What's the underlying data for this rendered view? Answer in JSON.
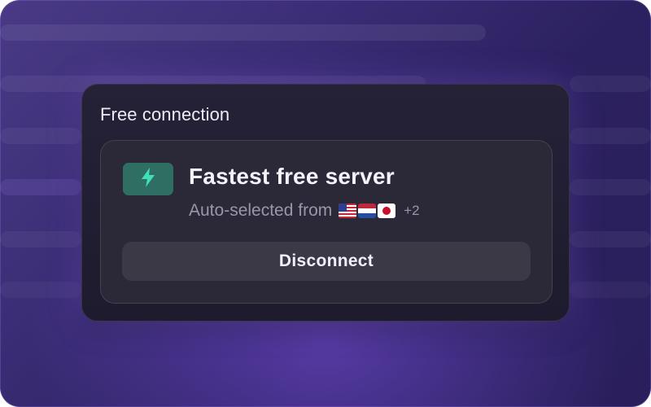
{
  "panel": {
    "title": "Free connection"
  },
  "server_card": {
    "title": "Fastest free server",
    "subtitle": "Auto-selected from",
    "flags": [
      "us-flag-icon",
      "nl-flag-icon",
      "jp-flag-icon"
    ],
    "more_count": "+2",
    "accent_color": "#2f6f63",
    "icon_color": "#3fe0b8"
  },
  "actions": {
    "disconnect_label": "Disconnect"
  }
}
